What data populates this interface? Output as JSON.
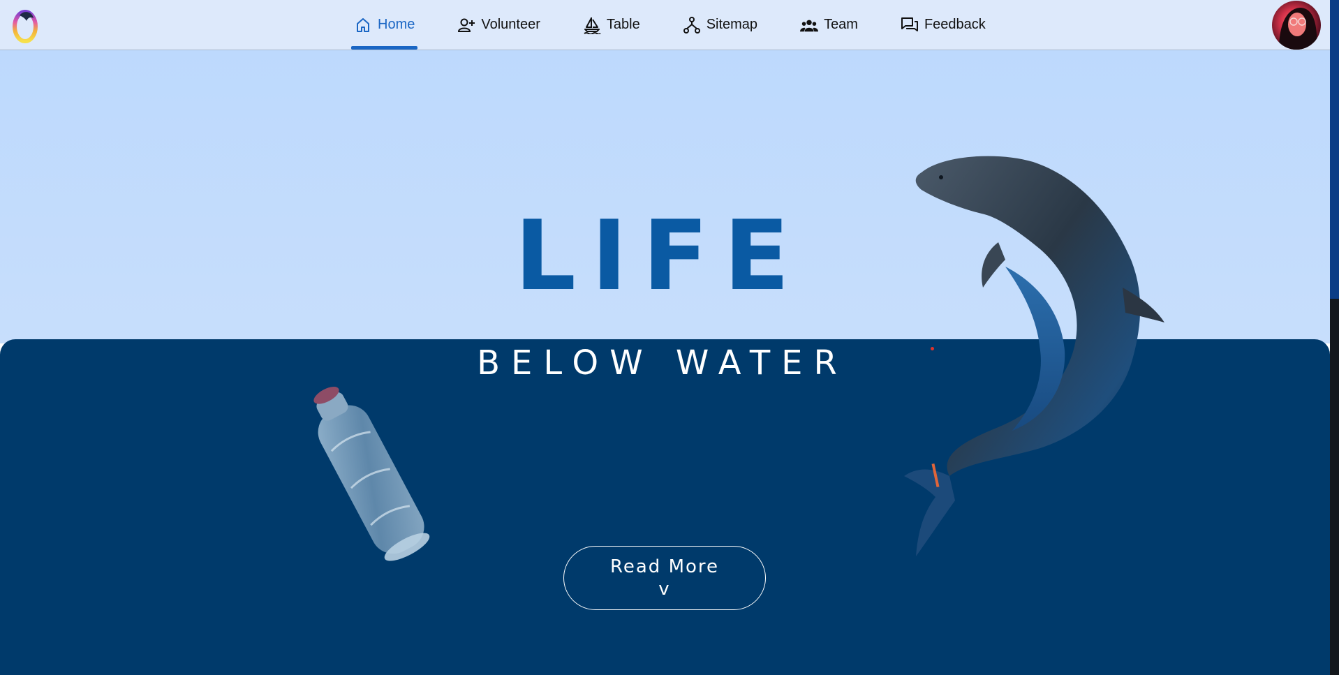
{
  "nav": {
    "items": [
      {
        "label": "Home",
        "icon": "home-icon",
        "active": true
      },
      {
        "label": "Volunteer",
        "icon": "person-add-icon",
        "active": false
      },
      {
        "label": "Table",
        "icon": "sailboat-icon",
        "active": false
      },
      {
        "label": "Sitemap",
        "icon": "sitemap-icon",
        "active": false
      },
      {
        "label": "Team",
        "icon": "people-icon",
        "active": false
      },
      {
        "label": "Feedback",
        "icon": "chat-icon",
        "active": false
      }
    ],
    "logo_icon": "dolphin-ring-logo",
    "avatar_icon": "user-avatar"
  },
  "hero": {
    "title": "LIFE",
    "subtitle": "BELOW WATER",
    "button_label": "Read More",
    "button_chevron": "v"
  },
  "colors": {
    "accent": "#1a66c4",
    "hero_top": "#c3dcfc",
    "hero_bottom": "#003a6b",
    "title": "#0a5aa3"
  }
}
